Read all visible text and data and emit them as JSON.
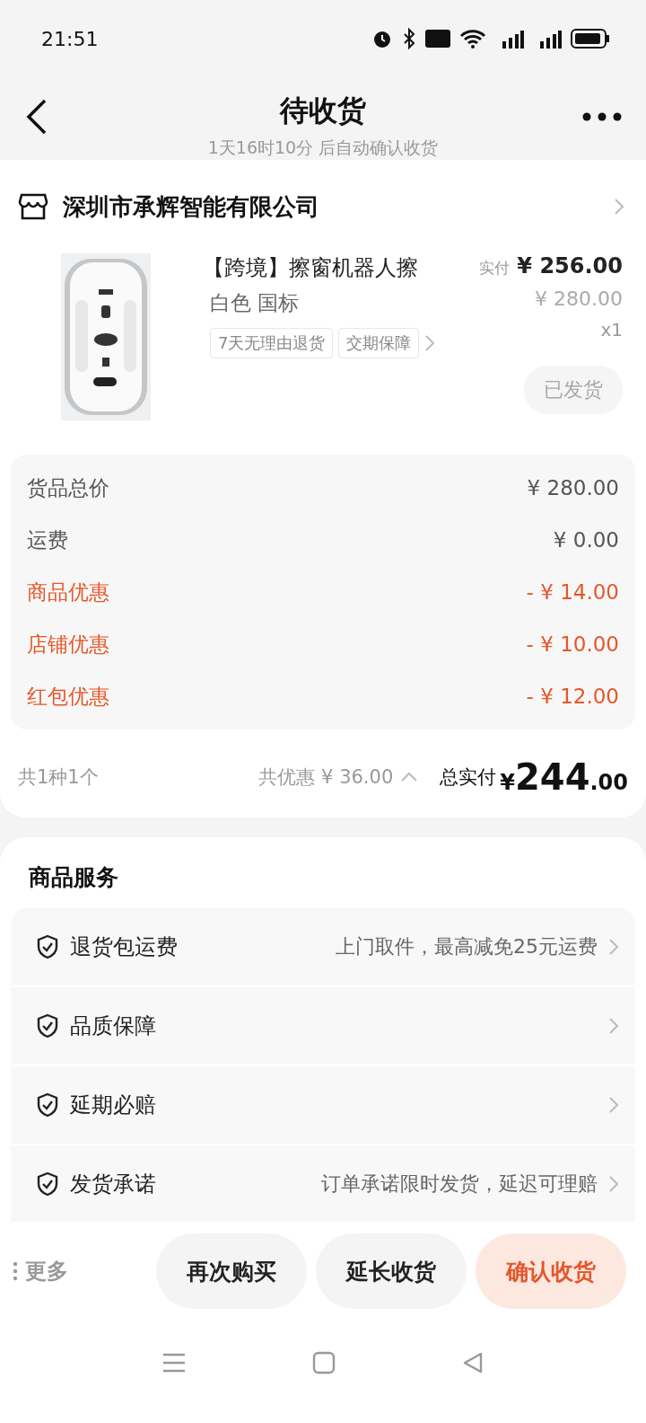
{
  "status_bar": {
    "time": "21:51"
  },
  "header": {
    "title": "待收货",
    "subtitle": "1天16时10分 后自动确认收货"
  },
  "shop": {
    "name": "深圳市承辉智能有限公司"
  },
  "product": {
    "image": {
      "kind": "picture"
    },
    "title": "【跨境】擦窗机器人擦",
    "variant": "白色 国标",
    "tags": [
      "7天无理由退货",
      "交期保障"
    ],
    "paid_label": "实付",
    "paid_price": "¥ 256.00",
    "original_price": "¥ 280.00",
    "quantity": "x1",
    "status_button": {
      "label": "已发货",
      "disabled": true
    }
  },
  "price_details": [
    {
      "label": "货品总价",
      "value": "¥ 280.00",
      "kind": "normal"
    },
    {
      "label": "运费",
      "value": "¥ 0.00",
      "kind": "normal"
    },
    {
      "label": "商品优惠",
      "value": "- ¥ 14.00",
      "kind": "discount"
    },
    {
      "label": "店铺优惠",
      "value": "- ¥ 10.00",
      "kind": "discount"
    },
    {
      "label": "红包优惠",
      "value": "- ¥ 12.00",
      "kind": "discount"
    }
  ],
  "totals": {
    "count": "共1种1个",
    "discount": "共优惠 ¥ 36.00",
    "total_label": "总实付",
    "currency": "¥",
    "integer": "244",
    "decimal": ".00"
  },
  "services": {
    "title": "商品服务",
    "items": [
      {
        "label": "退货包运费",
        "detail": "上门取件，最高减免25元运费"
      },
      {
        "label": "品质保障"
      },
      {
        "label": "延期必赔"
      },
      {
        "label": "发货承诺",
        "detail": "订单承诺限时发货，延迟可理赔"
      }
    ]
  },
  "actions": {
    "more": "更多",
    "buttons": [
      {
        "label": "再次购买",
        "kind": "secondary"
      },
      {
        "label": "延长收货",
        "kind": "secondary"
      },
      {
        "label": "确认收货",
        "kind": "primary"
      }
    ]
  }
}
